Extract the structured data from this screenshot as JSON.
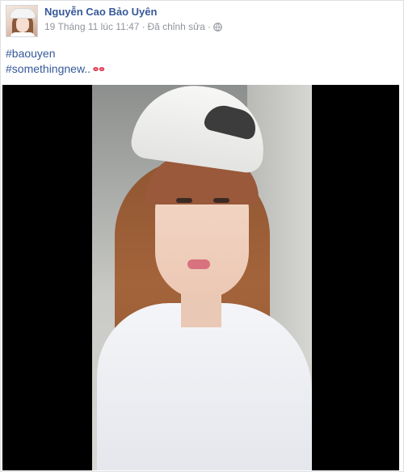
{
  "post": {
    "author_name": "Nguyễn Cao Bảo Uyên",
    "timestamp": "19 Tháng 11 lúc 11:47",
    "separator": "·",
    "edited_label": "Đã chỉnh sửa",
    "privacy_icon": "globe-icon",
    "hashtags": [
      "#baouyen",
      "#somethingnew.."
    ],
    "emoji_icon": "kissing-lips-icon",
    "colors": {
      "link": "#365899",
      "meta": "#90949c",
      "video_letterbox": "#000000"
    }
  }
}
